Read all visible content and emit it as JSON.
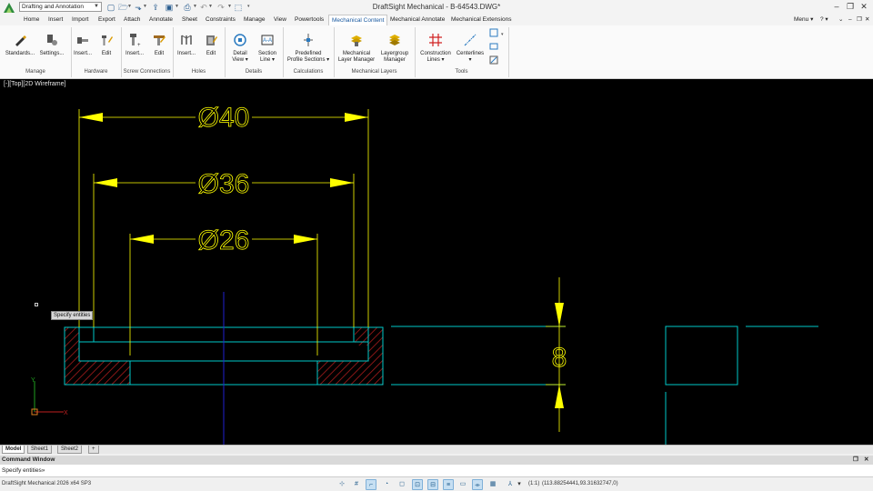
{
  "titlebar": {
    "workspace": "Drafting and Annotation",
    "title": "DraftSight Mechanical - B-64543.DWG*"
  },
  "menubar": {
    "tabs": [
      "Home",
      "Insert",
      "Import",
      "Export",
      "Attach",
      "Annotate",
      "Sheet",
      "Constraints",
      "Manage",
      "View",
      "Powertools",
      "Mechanical Content",
      "Mechanical Annotate",
      "Mechanical Extensions"
    ],
    "active_tab": "Mechanical Content",
    "menu_label": "Menu",
    "help_label": "?"
  },
  "ribbon": {
    "groups": {
      "manage": "Manage",
      "hardware": "Hardware",
      "screw": "Screw Connections",
      "holes": "Holes",
      "details": "Details",
      "calculations": "Calculations",
      "mech_layers": "Mechanical Layers",
      "tools": "Tools"
    },
    "buttons": {
      "standards": "Standards...",
      "settings": "Settings...",
      "hw_insert": "Insert...",
      "hw_edit": "Edit",
      "sc_insert": "Insert...",
      "sc_edit": "Edit",
      "holes_insert": "Insert...",
      "holes_edit": "Edit",
      "detail_view_1": "Detail",
      "detail_view_2": "View",
      "section_line_1": "Section",
      "section_line_2": "Line",
      "predef_1": "Predefined",
      "predef_2": "Profile Sections",
      "mlm_1": "Mechanical",
      "mlm_2": "Layer Manager",
      "lgm_1": "Layergroup",
      "lgm_2": "Manager",
      "cl_1": "Construction",
      "cl_2": "Lines",
      "centerlines": "Centerlines"
    }
  },
  "canvas": {
    "view_label": "[-][Top][2D Wireframe]",
    "tooltip": "Specify entities",
    "dimensions": [
      "Ø40",
      "Ø36",
      "Ø26",
      "8"
    ],
    "axis_y": "Y",
    "axis_x": "X"
  },
  "sheets": {
    "tabs": [
      "Model",
      "Sheet1",
      "Sheet2"
    ],
    "add_label": "+"
  },
  "command": {
    "header": "Command Window",
    "prompt": "Specify entities»"
  },
  "status": {
    "version": "DraftSight Mechanical 2026  x64 SP3",
    "scale": "(1:1)",
    "coords": "(113.88254441,93.31632747,0)"
  },
  "colors": {
    "canvas_bg": "#000000",
    "dimension_yellow": "#ffff00",
    "geometry_cyan": "#00c8c8",
    "hatch_red": "#b41e1e",
    "centerline_blue": "#2020d0",
    "active_tab": "#1a5aa0"
  }
}
